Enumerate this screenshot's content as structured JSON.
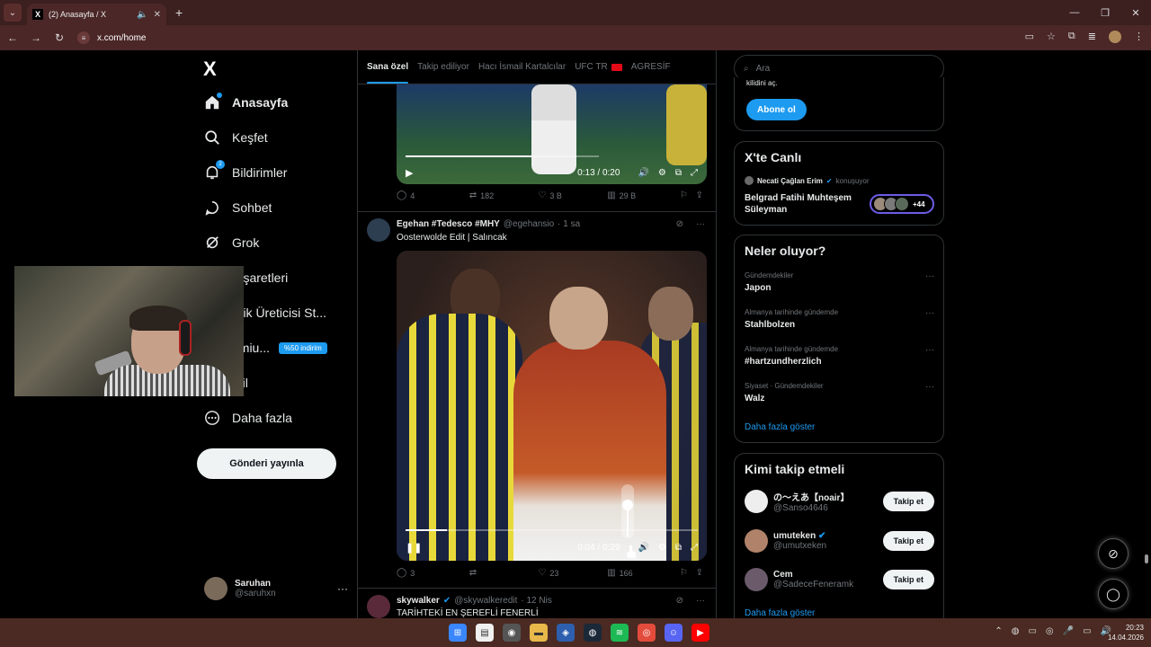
{
  "browser": {
    "tab_title": "(2) Anasayfa / X",
    "url": "x.com/home",
    "tab_favicon": "X"
  },
  "nav": {
    "logo": "X",
    "items": [
      {
        "label": "Anasayfa",
        "icon": "home-icon",
        "active": true
      },
      {
        "label": "Keşfet",
        "icon": "search-icon"
      },
      {
        "label": "Bildirimler",
        "icon": "bell-icon",
        "badge": "2"
      },
      {
        "label": "Sohbet",
        "icon": "chat-icon"
      },
      {
        "label": "Grok",
        "icon": "grok-icon"
      },
      {
        "label": "Yer İşaretleri",
        "icon": "bookmark-icon",
        "visible": "r İşaretleri"
      },
      {
        "label": "İçerik Üreticisi Stüdyosu",
        "icon": "studio-icon",
        "visible": "erik Üreticisi St..."
      },
      {
        "label": "Premium",
        "icon": "premium-icon",
        "visible": "emiu...",
        "badge": "%50 indirim"
      },
      {
        "label": "Profil",
        "icon": "profile-icon",
        "visible": "ofil"
      },
      {
        "label": "Daha fazla",
        "icon": "more-circle-icon"
      }
    ],
    "post_button": "Gönderi yayınla",
    "me": {
      "name": "Saruhan",
      "handle": "@saruhxn",
      "more": "···"
    }
  },
  "feed": {
    "tabs": [
      {
        "label": "Sana özel",
        "selected": true
      },
      {
        "label": "Takip ediliyor"
      },
      {
        "label": "Hacı İsmail Kartalcılar"
      },
      {
        "label": "UFC TR",
        "flag": true
      },
      {
        "label": "AGRESİF"
      }
    ],
    "tweet1": {
      "video_time": "0:13 / 0:20",
      "progress": 0.65,
      "replies": "4",
      "retweets": "182",
      "likes": "3 B",
      "views": "29 B"
    },
    "tweet2": {
      "name": "Egehan #Tedesco #MHY",
      "handle": "@egehansio",
      "time": "· 1 sa",
      "text": "Oosterwolde Edit | Salıncak",
      "video_time": "0:04 / 0:29",
      "progress": 0.14,
      "volume": 0.8,
      "replies": "3",
      "retweets": "",
      "likes": "23",
      "views": "166"
    },
    "tweet3": {
      "name": "skywalker",
      "handle": "@skywalkeredit",
      "time": "· 12 Nis",
      "text": "TARİHTEKİ EN ŞEREFLİ FENERLİ"
    }
  },
  "right": {
    "search_placeholder": "Ara",
    "premium_card": {
      "subscribe": "Abone ol",
      "truncated": "kilidini aç."
    },
    "live": {
      "title": "X'te Canlı",
      "host": "Necati Çağlan Erim",
      "status": "konuşuyor",
      "space_title": "Belgrad Fatihi Muhteşem Süleyman",
      "count": "+44"
    },
    "trends": {
      "title": "Neler oluyor?",
      "items": [
        {
          "category": "Gündemdekiler",
          "name": "Japon"
        },
        {
          "category": "Almanya tarihinde gündemde",
          "name": "Stahlbolzen"
        },
        {
          "category": "Almanya tarihinde gündemde",
          "name": "#hartzundherzlich"
        },
        {
          "category": "Siyaset · Gündemdekiler",
          "name": "Walz"
        }
      ],
      "show_more": "Daha fazla göster"
    },
    "who_to_follow": {
      "title": "Kimi takip etmeli",
      "items": [
        {
          "name": "の〜えあ【noair】",
          "handle": "@Sanso4646",
          "button": "Takip et"
        },
        {
          "name": "umuteken",
          "handle": "@umutxeken",
          "button": "Takip et",
          "verified": true
        },
        {
          "name": "Cem",
          "handle": "@SadeceFeneramk",
          "button": "Takip et"
        }
      ],
      "show_more": "Daha fazla göster"
    }
  },
  "taskbar": {
    "time": "20:23",
    "date": "14.04.2026"
  },
  "colors": {
    "accent": "#1d9bf0",
    "chrome": "#4b2727",
    "taskbar": "#4a2a22"
  }
}
